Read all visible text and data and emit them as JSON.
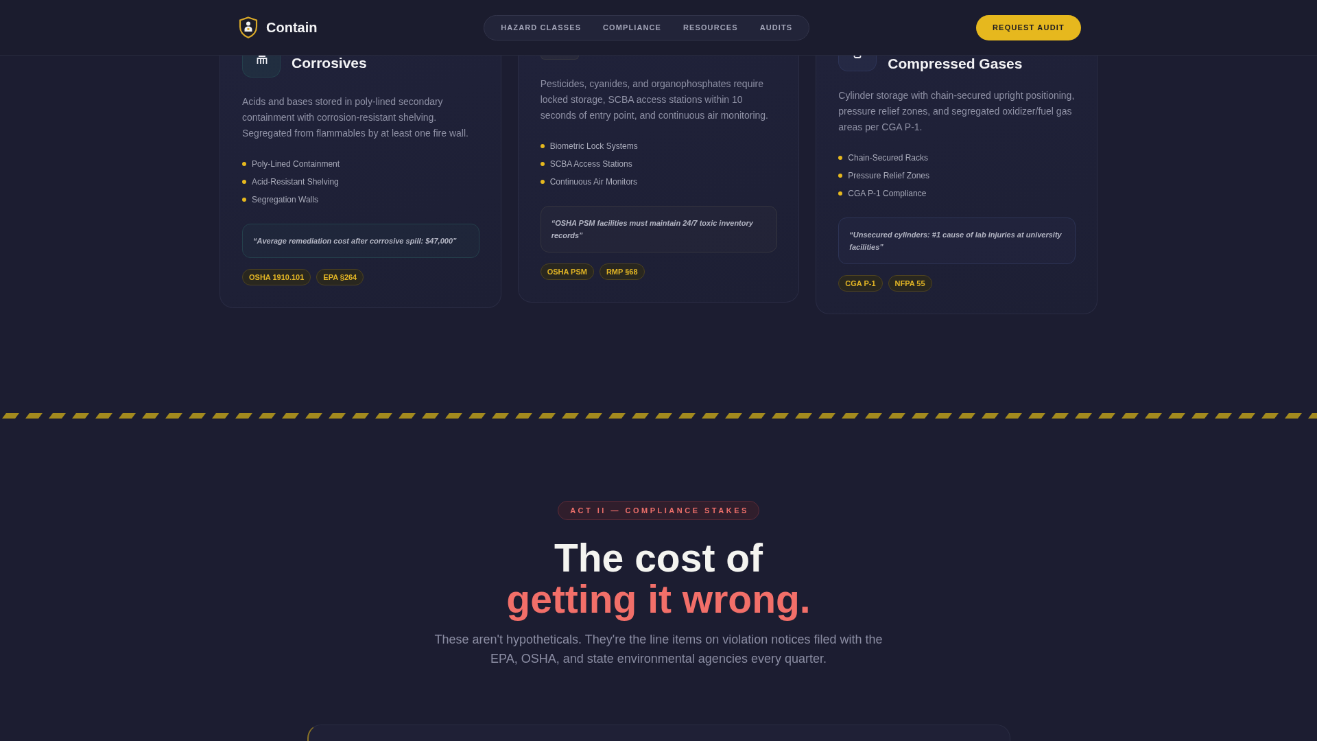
{
  "header": {
    "brand": "Contain",
    "nav": [
      "HAZARD CLASSES",
      "COMPLIANCE",
      "RESOURCES",
      "AUDITS"
    ],
    "cta": "REQUEST AUDIT"
  },
  "cards": [
    {
      "title": "Corrosives",
      "color": "#24404c",
      "description": "Acids and bases stored in poly-lined secondary containment with corrosion-resistant shelving. Segregated from flammables by at least one fire wall.",
      "features": [
        "Poly-Lined Containment",
        "Acid-Resistant Shelving",
        "Segregation Walls"
      ],
      "quote": "“Average remediation cost after corrosive spill: $47,000”",
      "tags": [
        "OSHA 1910.101",
        "EPA §264"
      ]
    },
    {
      "color": "#35353f",
      "description": "Pesticides, cyanides, and organophosphates require locked storage, SCBA access stations within 10 seconds of entry point, and continuous air monitoring.",
      "features": [
        "Biometric Lock Systems",
        "SCBA Access Stations",
        "Continuous Air Monitors"
      ],
      "quote": "“OSHA PSM facilities must maintain 24/7 toxic inventory records”",
      "tags": [
        "OSHA PSM",
        "RMP §68"
      ]
    },
    {
      "title": "Compressed Gases",
      "color": "#2d3456",
      "description": "Cylinder storage with chain-secured upright positioning, pressure relief zones, and segregated oxidizer/fuel gas areas per CGA P-1.",
      "features": [
        "Chain-Secured Racks",
        "Pressure Relief Zones",
        "CGA P-1 Compliance"
      ],
      "quote": "“Unsecured cylinders: #1 cause of lab injuries at university facilities”",
      "tags": [
        "CGA P-1",
        "NFPA 55"
      ]
    }
  ],
  "stakes": {
    "badge": "ACT II — COMPLIANCE STAKES",
    "heading": "The cost of",
    "heading_highlight": "getting it wrong.",
    "lead": "These aren't hypotheticals. They're the line items on violation notices filed with the EPA, OSHA, and state environmental agencies every quarter."
  }
}
